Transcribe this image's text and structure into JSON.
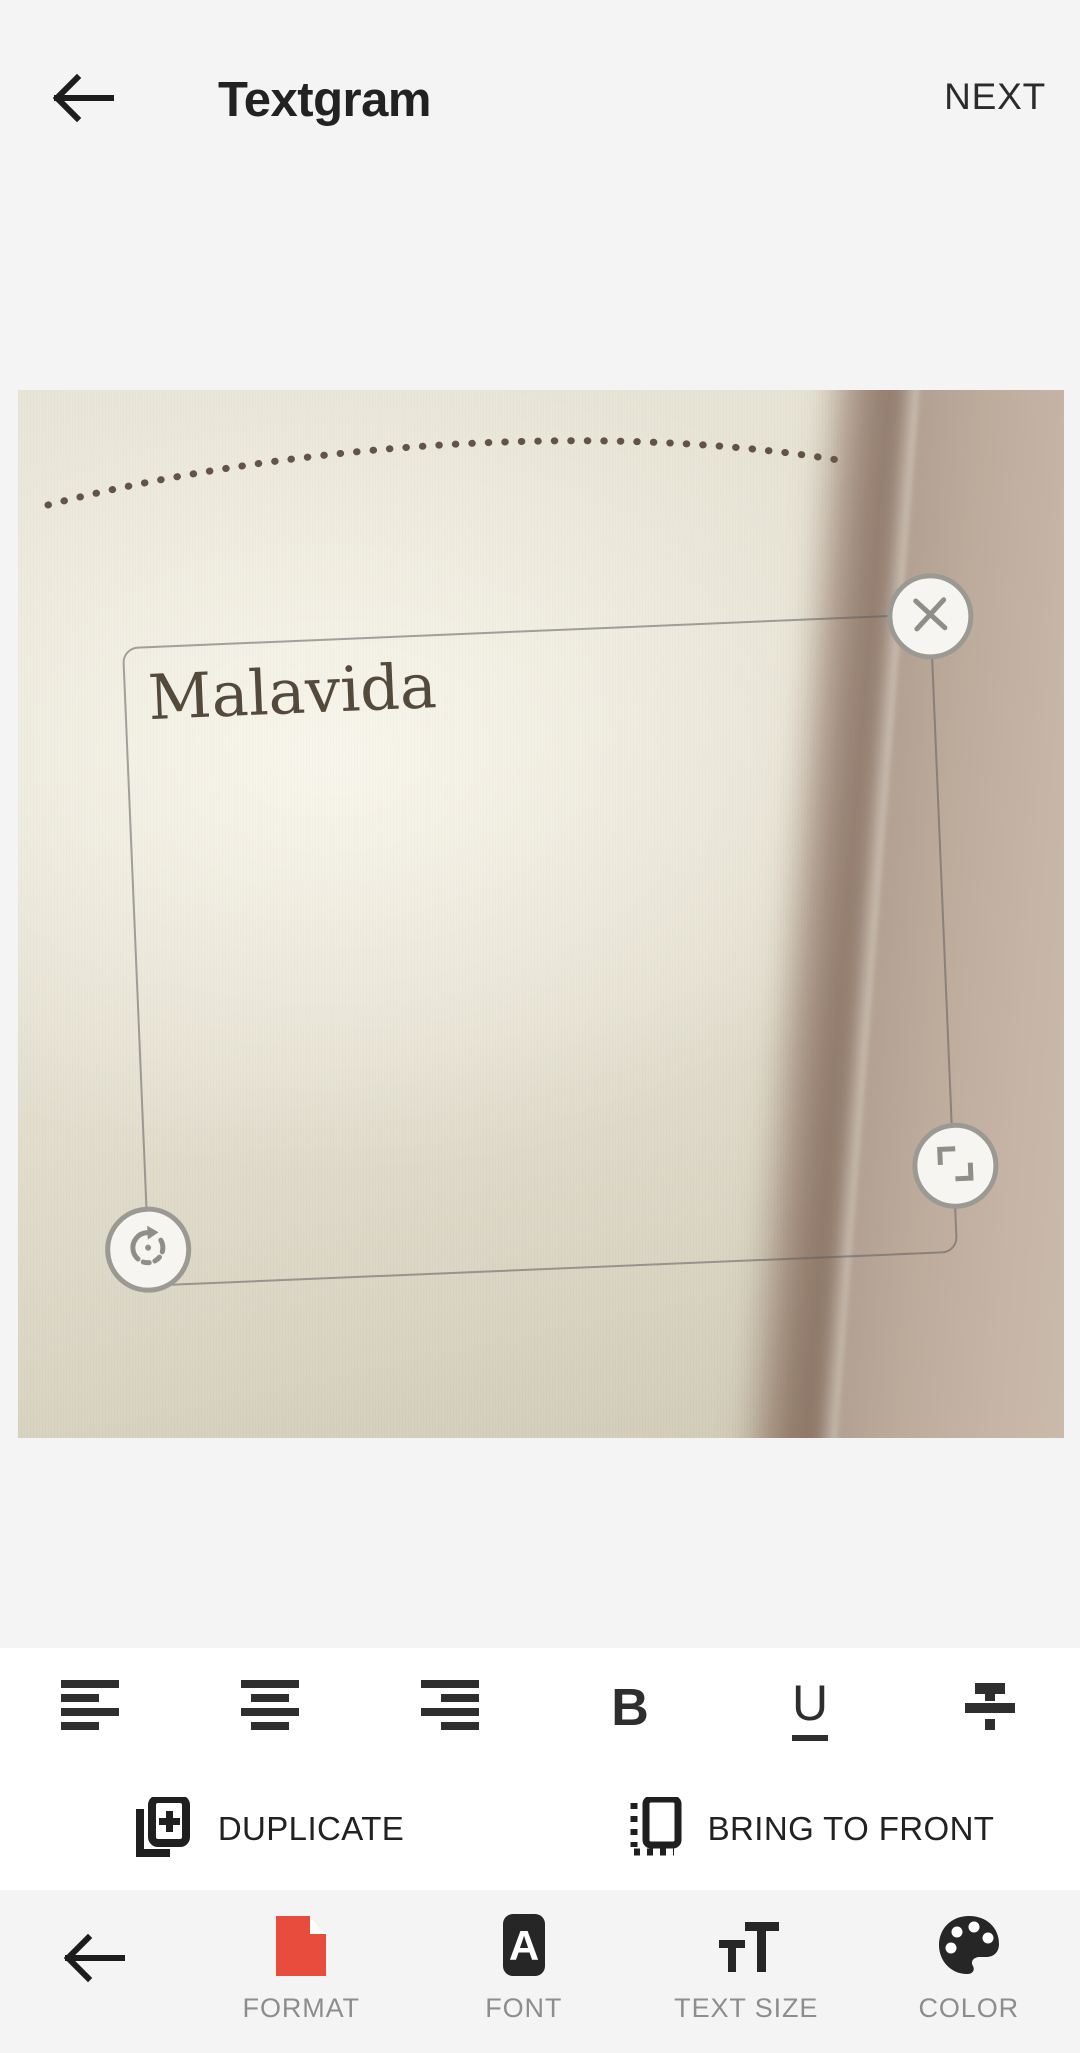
{
  "header": {
    "back_icon": "arrow-left-icon",
    "title": "Textgram",
    "next_label": "NEXT"
  },
  "canvas": {
    "photo_description": "cream notebook paper with dotted perforation curve and shadowed page edge",
    "textbox": {
      "text": "Malavida",
      "close_icon": "close-icon",
      "rotate_icon": "rotate-icon",
      "resize_icon": "resize-icon"
    }
  },
  "toolbar": {
    "align_items": [
      {
        "name": "align-left",
        "icon": "align-left-icon"
      },
      {
        "name": "align-center",
        "icon": "align-center-icon"
      },
      {
        "name": "align-right",
        "icon": "align-right-icon"
      },
      {
        "name": "bold",
        "icon": "bold-icon",
        "glyph": "B"
      },
      {
        "name": "underline",
        "icon": "underline-icon",
        "glyph": "U"
      },
      {
        "name": "strikethrough",
        "icon": "strikethrough-icon"
      }
    ],
    "actions": [
      {
        "name": "duplicate",
        "label": "DUPLICATE",
        "icon": "duplicate-icon"
      },
      {
        "name": "bring-to-front",
        "label": "BRING TO FRONT",
        "icon": "bring-to-front-icon"
      }
    ]
  },
  "bottom_nav": {
    "back_icon": "arrow-left-icon",
    "items": [
      {
        "name": "format",
        "label": "FORMAT",
        "icon": "format-document-icon",
        "active": true
      },
      {
        "name": "font",
        "label": "FONT",
        "icon": "font-a-icon",
        "active": false
      },
      {
        "name": "text-size",
        "label": "TEXT SIZE",
        "icon": "text-size-icon",
        "active": false
      },
      {
        "name": "color",
        "label": "COLOR",
        "icon": "color-palette-icon",
        "active": false
      }
    ]
  },
  "colors": {
    "accent_red": "#E74C3C",
    "background": "#F4F4F4",
    "toolbar_bg": "#FFFFFF",
    "text_dark": "#222222",
    "label_gray": "#8D8D8D",
    "textbox_text": "#544A3C",
    "handle_border": "#9A9A93"
  }
}
